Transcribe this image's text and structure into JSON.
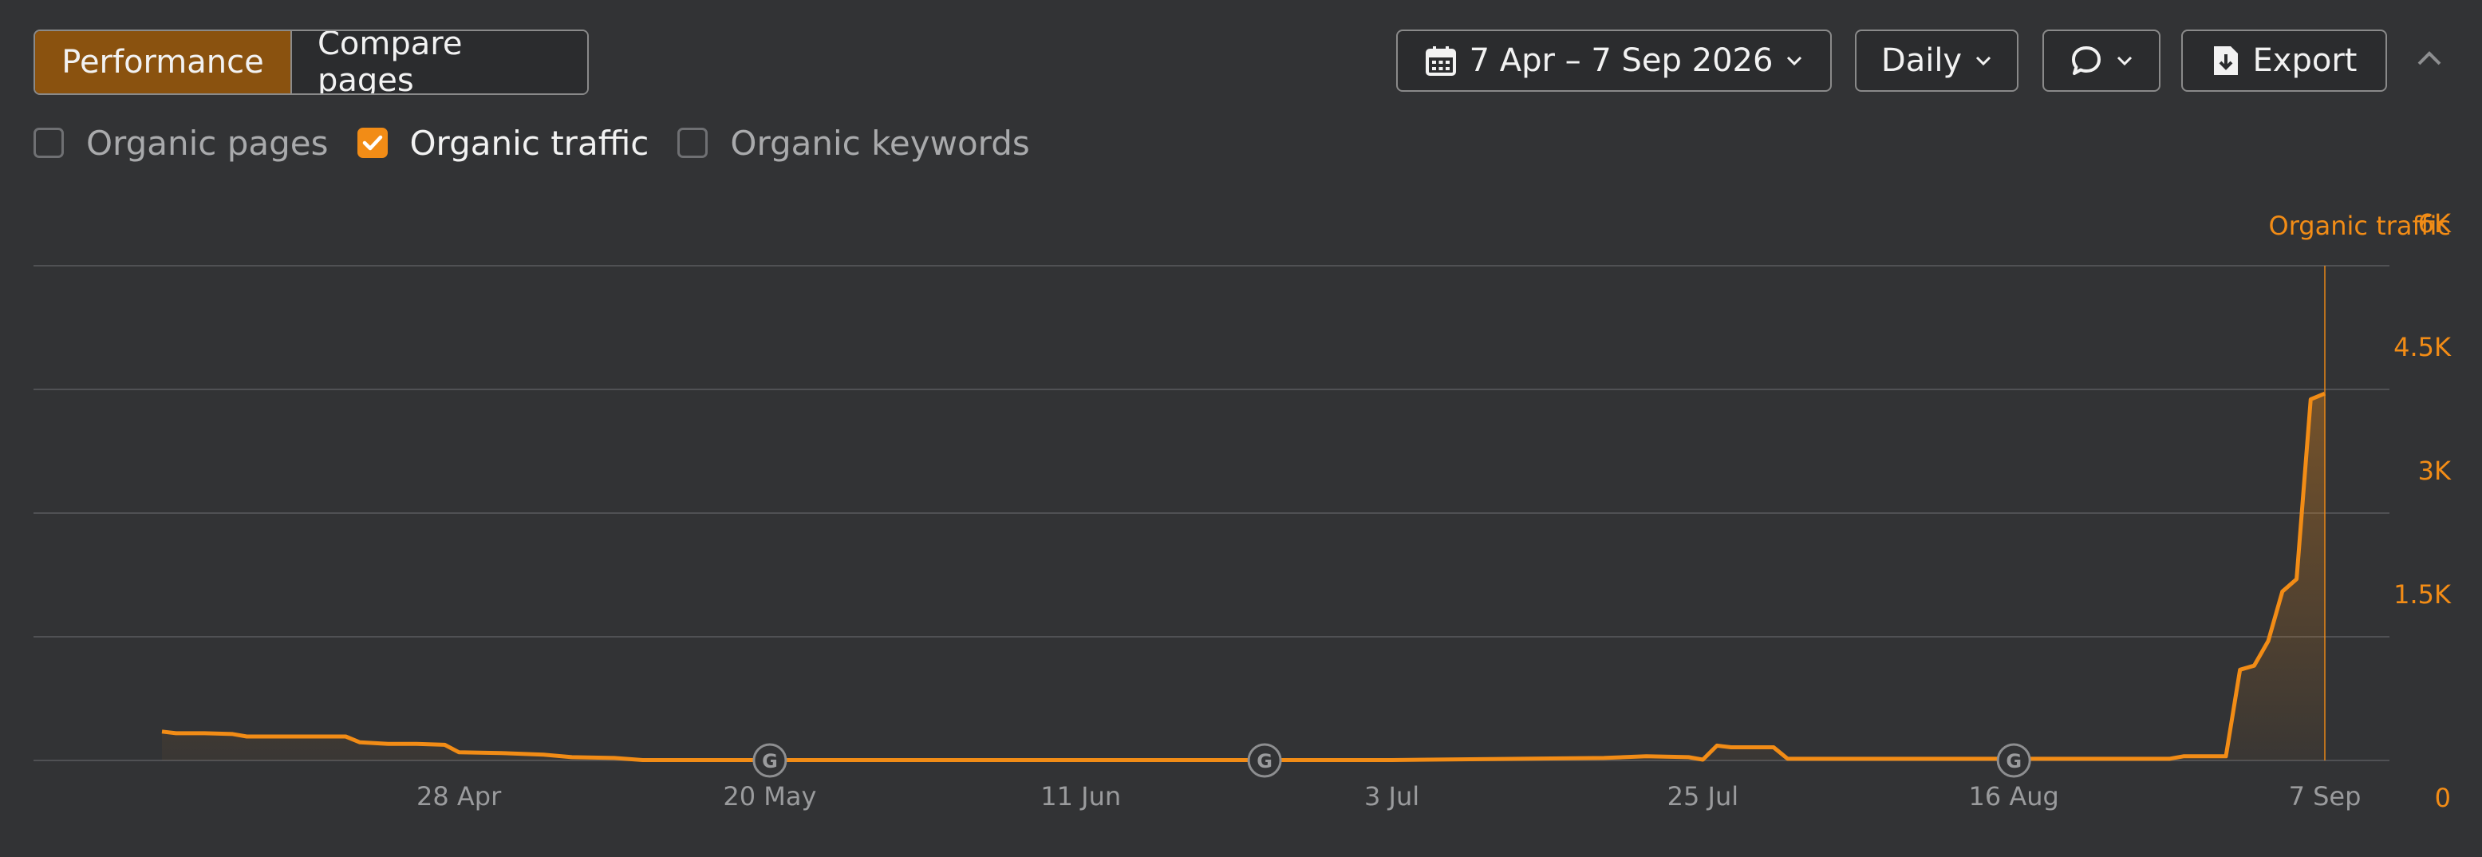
{
  "tabs": {
    "performance": "Performance",
    "compare": "Compare pages"
  },
  "toolbar": {
    "date_range": "7 Apr – 7 Sep 2026",
    "granularity": "Daily",
    "export": "Export"
  },
  "metrics": [
    {
      "label": "Organic pages",
      "checked": false
    },
    {
      "label": "Organic traffic",
      "checked": true
    },
    {
      "label": "Organic keywords",
      "checked": false
    }
  ],
  "colors": {
    "accent": "#f28c16",
    "grid": "#505154",
    "background": "#323335"
  },
  "icons": [
    "calendar-icon",
    "chevron-down-icon",
    "comment-icon",
    "export-file-icon",
    "chevron-up-icon",
    "google-update-icon"
  ],
  "chart_data": {
    "type": "area",
    "ylabel": "Organic traffic",
    "ylim": [
      0,
      6000
    ],
    "yticks": [
      {
        "value": 0,
        "label": "0"
      },
      {
        "value": 1500,
        "label": "1.5K"
      },
      {
        "value": 3000,
        "label": "3K"
      },
      {
        "value": 4500,
        "label": "4.5K"
      },
      {
        "value": 6000,
        "label": "6K"
      }
    ],
    "xlim": [
      "2026-04-07",
      "2026-09-07"
    ],
    "xticks": [
      {
        "date": "2026-04-28",
        "label": "28 Apr"
      },
      {
        "date": "2026-05-20",
        "label": "20 May"
      },
      {
        "date": "2026-06-11",
        "label": "11 Jun"
      },
      {
        "date": "2026-07-03",
        "label": "3 Jul"
      },
      {
        "date": "2026-07-25",
        "label": "25 Jul"
      },
      {
        "date": "2026-08-16",
        "label": "16 Aug"
      },
      {
        "date": "2026-09-07",
        "label": "7 Sep"
      }
    ],
    "google_updates": [
      "2026-05-20",
      "2026-06-24",
      "2026-08-16"
    ],
    "cursor_date": "2026-09-07",
    "grid": true,
    "series": [
      {
        "name": "Organic traffic",
        "points": [
          [
            "2026-04-07",
            350
          ],
          [
            "2026-04-08",
            330
          ],
          [
            "2026-04-10",
            330
          ],
          [
            "2026-04-12",
            320
          ],
          [
            "2026-04-13",
            290
          ],
          [
            "2026-04-16",
            290
          ],
          [
            "2026-04-20",
            290
          ],
          [
            "2026-04-21",
            220
          ],
          [
            "2026-04-23",
            200
          ],
          [
            "2026-04-25",
            200
          ],
          [
            "2026-04-27",
            190
          ],
          [
            "2026-04-28",
            100
          ],
          [
            "2026-05-01",
            90
          ],
          [
            "2026-05-04",
            70
          ],
          [
            "2026-05-06",
            40
          ],
          [
            "2026-05-09",
            30
          ],
          [
            "2026-05-11",
            5
          ],
          [
            "2026-05-20",
            5
          ],
          [
            "2026-06-11",
            5
          ],
          [
            "2026-07-03",
            5
          ],
          [
            "2026-07-18",
            30
          ],
          [
            "2026-07-21",
            50
          ],
          [
            "2026-07-24",
            40
          ],
          [
            "2026-07-25",
            10
          ],
          [
            "2026-07-26",
            180
          ],
          [
            "2026-07-27",
            160
          ],
          [
            "2026-07-30",
            160
          ],
          [
            "2026-07-31",
            20
          ],
          [
            "2026-08-16",
            20
          ],
          [
            "2026-08-27",
            20
          ],
          [
            "2026-08-28",
            50
          ],
          [
            "2026-08-31",
            50
          ],
          [
            "2026-09-01",
            1100
          ],
          [
            "2026-09-02",
            1150
          ],
          [
            "2026-09-03",
            1450
          ],
          [
            "2026-09-04",
            2050
          ],
          [
            "2026-09-05",
            2200
          ],
          [
            "2026-09-06",
            4380
          ],
          [
            "2026-09-07",
            4450
          ]
        ]
      }
    ]
  }
}
